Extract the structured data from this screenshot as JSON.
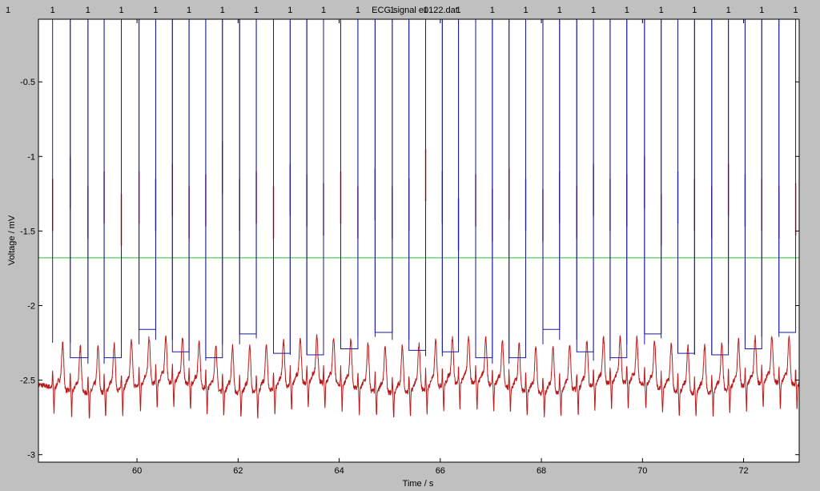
{
  "chart_data": {
    "type": "line",
    "title": "ECG signal e0122.dat",
    "xlabel": "Time / s",
    "ylabel": "Voltage / mV",
    "xlim": [
      58.05,
      73.1
    ],
    "ylim": [
      -3.05,
      -0.08
    ],
    "x_ticks": [
      60,
      62,
      64,
      66,
      68,
      70,
      72
    ],
    "y_ticks": [
      -3,
      -2.5,
      -2,
      -1.5,
      -1,
      -0.5
    ],
    "x_tick_labels": [
      "60",
      "62",
      "64",
      "66",
      "68",
      "70",
      "72"
    ],
    "y_tick_labels": [
      "-3",
      "-2.5",
      "-2",
      "-1.5",
      "-1",
      "-0.5"
    ],
    "grid": false,
    "background": "#ffffff",
    "figure_background": "#c0c0c0",
    "threshold": {
      "value": -1.68,
      "color": "#33bb33"
    },
    "beat_marker_label": "1",
    "beat_marker_color": "#1a1a99",
    "ecg_color": "#bb1a1a",
    "series": [
      {
        "role": "ecg",
        "r_peak_times": [
          58.33,
          58.68,
          59.03,
          59.35,
          59.69,
          60.04,
          60.37,
          60.7,
          61.03,
          61.36,
          61.69,
          62.03,
          62.36,
          62.7,
          63.03,
          63.36,
          63.69,
          64.03,
          64.37,
          64.71,
          65.05,
          65.38,
          65.71,
          66.04,
          66.36,
          66.7,
          67.03,
          67.36,
          67.69,
          68.03,
          68.36,
          68.7,
          69.03,
          69.36,
          69.69,
          70.04,
          70.37,
          70.7,
          71.03,
          71.37,
          71.7,
          72.03,
          72.36,
          72.7,
          73.03
        ],
        "r_peak_values": [
          -1.15,
          -1.0,
          -1.2,
          -1.1,
          -1.25,
          -1.1,
          -1.15,
          -1.05,
          -1.2,
          -1.12,
          -0.9,
          -1.15,
          -1.1,
          -1.2,
          -1.05,
          -1.12,
          -1.18,
          -1.1,
          -1.2,
          -1.08,
          -1.2,
          -1.15,
          -0.95,
          -1.1,
          -1.28,
          -1.12,
          -1.22,
          -1.08,
          -1.15,
          -1.22,
          -1.1,
          -1.2,
          -1.05,
          -1.15,
          -1.12,
          -1.0,
          -1.25,
          -1.1,
          -1.15,
          -1.2,
          -1.05,
          -1.12,
          -1.15,
          -1.2,
          -1.18
        ],
        "baseline": -2.55,
        "s_trough": -2.62,
        "t_wave_peak": -2.25
      },
      {
        "role": "beat-markers",
        "lower_levels": [
          -2.25,
          -2.35,
          -2.39,
          -2.35,
          -2.26,
          -2.16,
          -2.23,
          -2.31,
          -2.37,
          -2.35,
          -2.26,
          -2.19,
          -2.22,
          -2.32,
          -2.33,
          -2.33,
          -2.26,
          -2.29,
          -2.21,
          -2.18,
          -2.23,
          -2.3,
          -2.34,
          -2.31
        ]
      }
    ]
  }
}
